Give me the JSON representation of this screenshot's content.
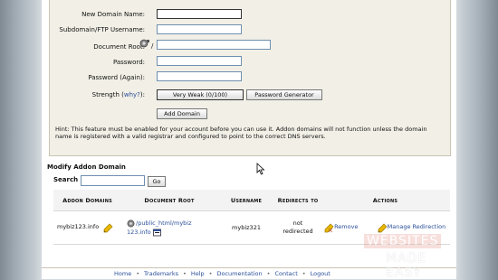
{
  "form": {
    "new_domain_label": "New Domain Name:",
    "subdomain_label": "Subdomain/FTP Username:",
    "docroot_label": "Document Root:",
    "docroot_prefix": "/",
    "password_label": "Password:",
    "password_again_label": "Password (Again):",
    "strength_label": "Strength (",
    "why_link": "why?",
    "strength_close": "):",
    "strength_value": "Very Weak (0/100)",
    "password_generator_label": "Password Generator",
    "add_domain_label": "Add Domain",
    "hint": "Hint: This feature must be enabled for your account before you can use it. Addon domains will not function unless the domain name is registered with a valid registrar and configured to point to the correct DNS servers."
  },
  "modify": {
    "title": "Modify Addon Domain",
    "search_label": "Search",
    "search_value": "",
    "go_label": "Go"
  },
  "table": {
    "headers": {
      "addon_domains": "Addon Domains",
      "document_root": "Document Root",
      "username": "Username",
      "redirects_to": "Redirects to",
      "actions": "Actions"
    },
    "rows": [
      {
        "domain": "mybiz123.info",
        "docroot_line1": "/public_html/mybiz",
        "docroot_line2": "123.info",
        "username": "mybiz321",
        "redirect_line1": "not",
        "redirect_line2": "redirected",
        "remove": "Remove",
        "manage_redirection": "Manage Redirection"
      }
    ]
  },
  "footer": {
    "links": [
      "Home",
      "Trademarks",
      "Help",
      "Documentation",
      "Contact",
      "Logout"
    ],
    "separator": "•"
  },
  "watermark": {
    "line1": "WEBSITES",
    "line2": "MADE EASY"
  },
  "colors": {
    "link": "#2a4f9a",
    "panel": "#f1efe6",
    "edit_icon": "#e8b800"
  }
}
